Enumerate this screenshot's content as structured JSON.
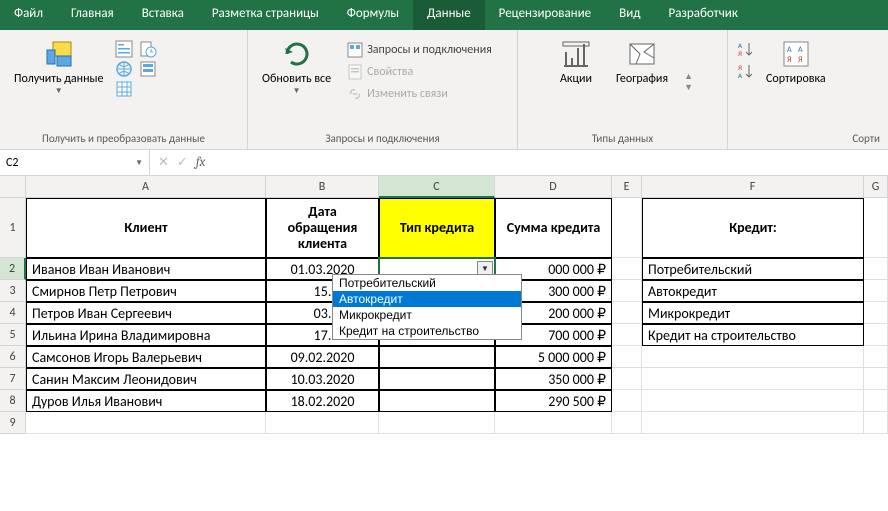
{
  "menu": {
    "tabs": [
      "Файл",
      "Главная",
      "Вставка",
      "Разметка страницы",
      "Формулы",
      "Данные",
      "Рецензирование",
      "Вид",
      "Разработчик"
    ],
    "active": 5
  },
  "ribbon": {
    "g1": {
      "get_data": "Получить\nданные",
      "label": "Получить и преобразовать данные"
    },
    "g2": {
      "refresh": "Обновить\nвсе",
      "q_conn": "Запросы и подключения",
      "props": "Свойства",
      "edit_links": "Изменить связи",
      "label": "Запросы и подключения"
    },
    "g3": {
      "stocks": "Акции",
      "geo": "География",
      "label": "Типы данных"
    },
    "g4": {
      "sort": "Сортировка",
      "label": "Сорти"
    }
  },
  "fbar": {
    "name": "C2",
    "value": ""
  },
  "cols": [
    "A",
    "B",
    "C",
    "D",
    "E",
    "F",
    "G"
  ],
  "colw": [
    "cA",
    "cB",
    "cC",
    "cD",
    "cE",
    "cF",
    "cG"
  ],
  "head": {
    "A": "Клиент",
    "B": "Дата обращения клиента",
    "C": "Тип кредита",
    "D": "Сумма кредита",
    "F": "Кредит:"
  },
  "rows": [
    {
      "n": "2",
      "A": "Иванов Иван Иванович",
      "B": "01.03.2020",
      "C": "",
      "D": "000 000 ₽",
      "dd": true
    },
    {
      "n": "3",
      "A": "Смирнов Петр Петрович",
      "B": "15.",
      "C": "",
      "D": "300 000 ₽"
    },
    {
      "n": "4",
      "A": "Петров Иван Сергеевич",
      "B": "03.",
      "C": "",
      "D": "200 000 ₽"
    },
    {
      "n": "5",
      "A": "Ильина Ирина Владимировна",
      "B": "17.",
      "C": "",
      "D": "700 000 ₽"
    },
    {
      "n": "6",
      "A": "Самсонов Игорь Валерьевич",
      "B": "09.02.2020",
      "C": "",
      "D": "5 000 000 ₽"
    },
    {
      "n": "7",
      "A": "Санин Максим Леонидович",
      "B": "10.03.2020",
      "C": "",
      "D": "350 000 ₽"
    },
    {
      "n": "8",
      "A": "Дуров Илья Иванович",
      "B": "18.02.2020",
      "C": "",
      "D": "290 500 ₽"
    }
  ],
  "fcol": [
    "Потребительский",
    "Автокредит",
    "Микрокредит",
    "Кредит на строительство"
  ],
  "dropdown": {
    "opts": [
      "Потребительский",
      "Автокредит",
      "Микрокредит",
      "Кредит на строительство"
    ],
    "selected": 1
  }
}
